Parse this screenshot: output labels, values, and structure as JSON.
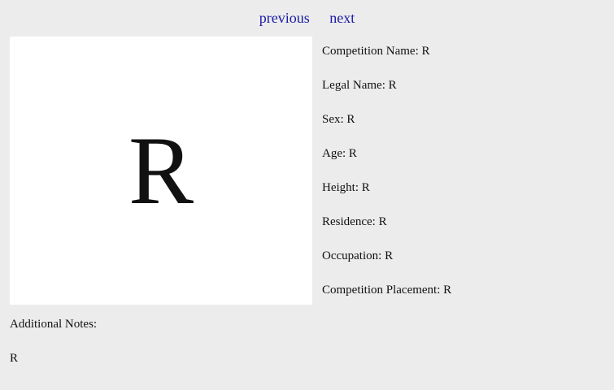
{
  "nav": {
    "previous_label": "previous",
    "next_label": "next",
    "link_color": "#1a1aa6"
  },
  "profile": {
    "image_letter": "R",
    "fields": [
      {
        "label": "Competition Name:",
        "value": "R"
      },
      {
        "label": "Legal Name:",
        "value": "R"
      },
      {
        "label": "Sex:",
        "value": "R"
      },
      {
        "label": "Age:",
        "value": "R"
      },
      {
        "label": "Height:",
        "value": "R"
      },
      {
        "label": "Residence:",
        "value": "R"
      },
      {
        "label": "Occupation:",
        "value": "R"
      },
      {
        "label": "Competition Placement:",
        "value": "R"
      }
    ],
    "notes_label": "Additional Notes:",
    "notes_value": "R"
  }
}
